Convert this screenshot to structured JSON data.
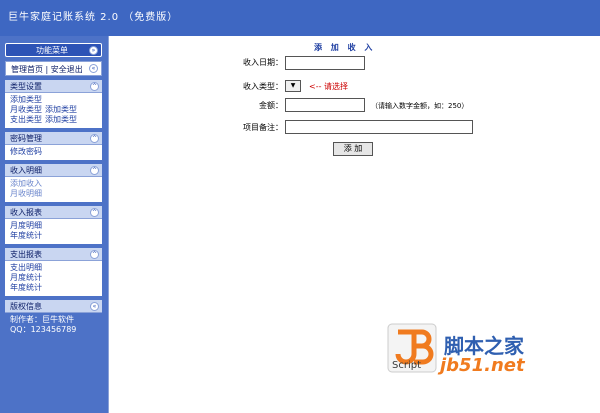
{
  "app": {
    "title": "巨牛家庭记账系统 2.0 （免费版）"
  },
  "sidebar": {
    "func_menu": "功能菜单",
    "quick_links": "管理首页 | 安全退出",
    "sections": [
      {
        "title": "类型设置",
        "rows": [
          [
            "添加类型"
          ],
          [
            "月收类型",
            "添加类型"
          ],
          [
            "支出类型",
            "添加类型"
          ]
        ]
      },
      {
        "title": "密码管理",
        "rows": [
          [
            "修改密码"
          ]
        ]
      },
      {
        "title": "收入明细",
        "rows": [
          [
            "添加收入"
          ],
          [
            "月收明细"
          ]
        ]
      },
      {
        "title": "收入报表",
        "rows": [
          [
            "月度明细"
          ],
          [
            "年度统计"
          ]
        ]
      },
      {
        "title": "支出报表",
        "rows": [
          [
            "支出明细"
          ],
          [
            "月度统计"
          ],
          [
            "年度统计"
          ]
        ]
      },
      {
        "title": "版权信息",
        "rows": [
          [
            "制作者：巨牛软件"
          ],
          [
            "QQ：123456789"
          ]
        ]
      }
    ]
  },
  "form": {
    "title": "添 加 收 入",
    "date_label": "收入日期：",
    "type_label": "收入类型：",
    "type_hint": "<-- 请选择",
    "amount_label": "金额：",
    "amount_hint": "（请输入数字金额，如：250）",
    "note_label": "项目备注：",
    "submit_label": "添 加"
  },
  "watermark": {
    "brand": "脚本之家",
    "url": "jb51.net",
    "script": "Script"
  },
  "colors": {
    "header": "#3e67c2",
    "sidebar": "#4d72c7",
    "accent": "#2d53b6",
    "red_hint": "#cc0000"
  }
}
